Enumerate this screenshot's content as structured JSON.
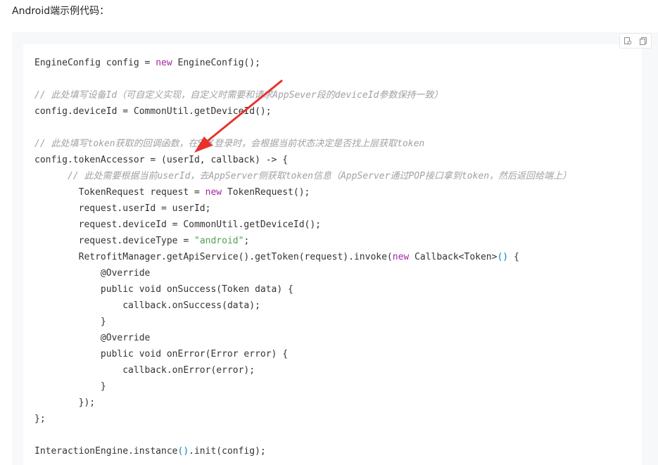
{
  "heading": "Android端示例代码：",
  "toolbar": {
    "icons": [
      "copy-to-editor-icon",
      "copy-icon"
    ]
  },
  "colors": {
    "keyword": "#a626a4",
    "string": "#50a14f",
    "comment": "#a0a1a7",
    "arrow": "#e8312a",
    "code_background": "#f6f8fa"
  },
  "code": {
    "l1": [
      "EngineConfig config = ",
      "new",
      " EngineConfig();"
    ],
    "l3": "// 此处填写设备Id（可自定义实现，自定义时需要和请求AppSever段的deviceId参数保持一致）",
    "l4": "config.deviceId = CommonUtil.getDeviceId();",
    "l6": "// 此处填写token获取的回调函数，在SDK登录时，会根据当前状态决定是否找上层获取token",
    "l7": "config.tokenAccessor = (userId, callback) -> {",
    "l8": "// 此处需要根据当前userId，去AppServer侧获取token信息（AppServer通过POP接口拿到token，然后返回给端上）",
    "l9": [
      "TokenRequest request = ",
      "new",
      " TokenRequest();"
    ],
    "l10": "request.userId = userId;",
    "l11": "request.deviceId = CommonUtil.getDeviceId();",
    "l12": [
      "request.deviceType = ",
      "\"android\"",
      ";"
    ],
    "l13": [
      "RetrofitManager.getApiService().getToken(request).invoke(",
      "new",
      " Callback<Token>",
      "()",
      " {"
    ],
    "l14": "@Override",
    "l15": "public void onSuccess(Token data) {",
    "l16": "callback.onSuccess(data);",
    "l17": "}",
    "l18": "@Override",
    "l19": "public void onError(Error error) {",
    "l20": "callback.onError(error);",
    "l21": "}",
    "l22": "});",
    "l23": "};",
    "l25": [
      "InteractionEngine.instance",
      "()",
      ".init(config);"
    ]
  }
}
